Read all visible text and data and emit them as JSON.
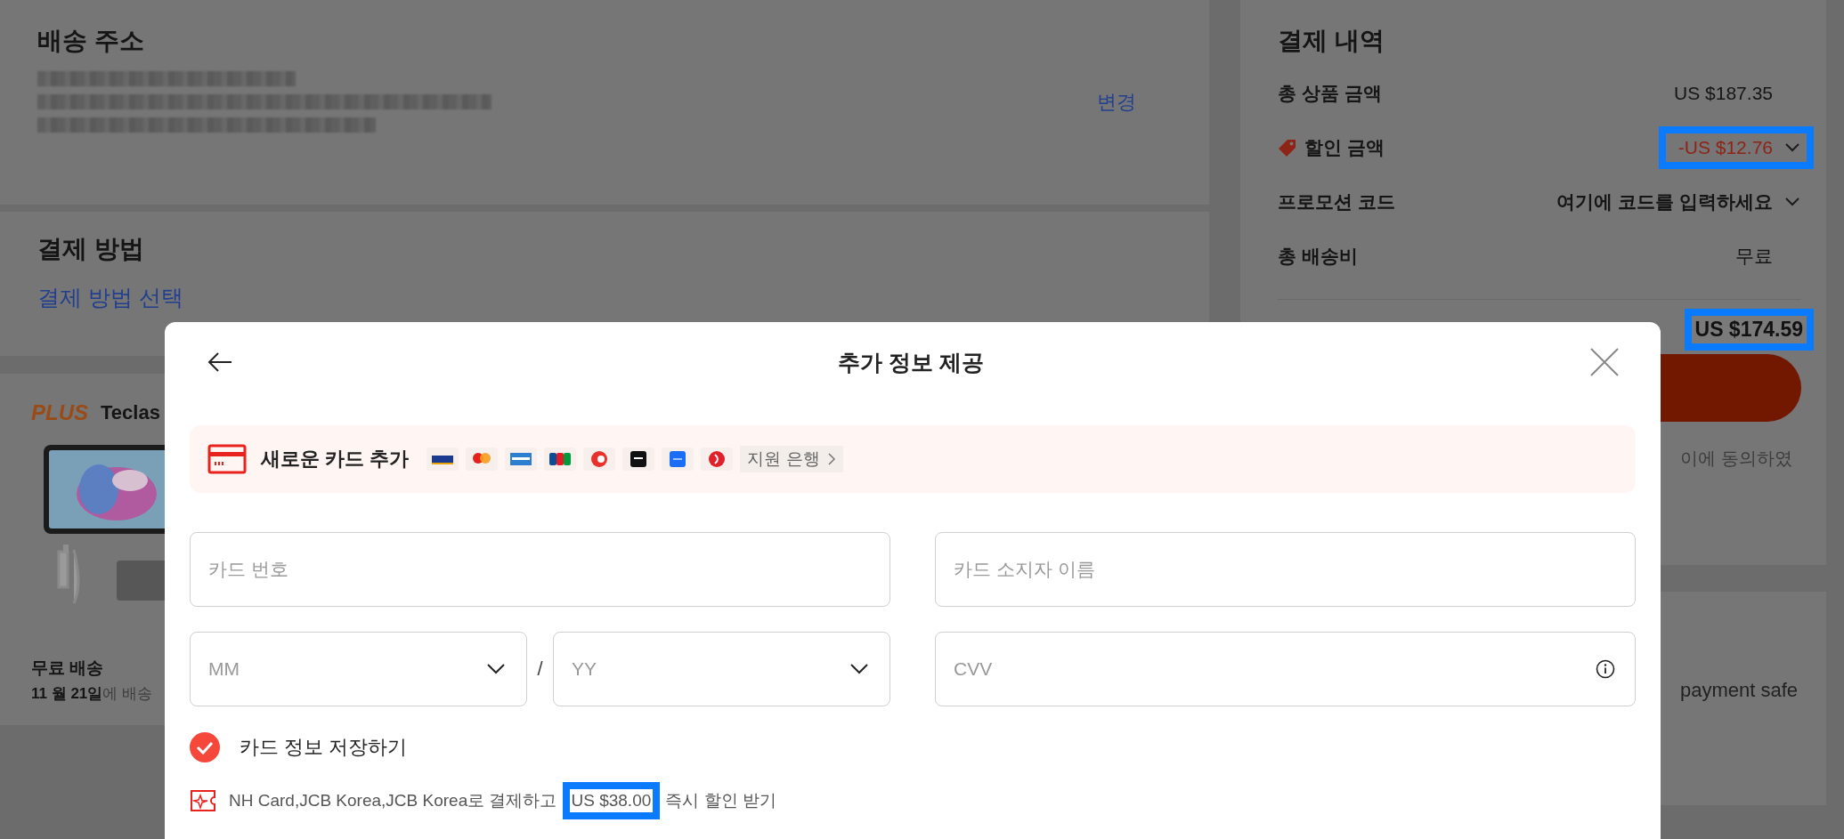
{
  "shipping_address": {
    "title": "배송 주소",
    "change_link": "변경"
  },
  "payment_method": {
    "title": "결제 방법",
    "select_link": "결제 방법 선택"
  },
  "product": {
    "badge": "PLUS",
    "store": "Teclas",
    "shipping": "무료 배송",
    "delivery": "**11 월 21일**에 배송"
  },
  "order_summary": {
    "title": "결제 내역",
    "rows": [
      {
        "kind": "amount",
        "label": "총 상품 금액",
        "value": "US $187.35",
        "highlighted": false
      },
      {
        "kind": "discount",
        "label": "할인 금액",
        "value": "-US $12.76",
        "highlighted": true
      },
      {
        "kind": "promo",
        "label": "프로모션 코드",
        "value": "여기에 코드를 입력하세요",
        "highlighted": false
      },
      {
        "kind": "amount",
        "label": "총 배송비",
        "value": "무료",
        "highlighted": false
      }
    ],
    "total": "US $174.59",
    "total_highlighted": true,
    "agreement": "이에 동의하였"
  },
  "safety": {
    "text": "payment safe"
  },
  "modal": {
    "title": "추가 정보 제공",
    "add_card": {
      "label": "새로운 카드 추가",
      "banks_link": "지원 은행"
    },
    "fields": [
      {
        "kind": "text",
        "placeholder": "카드 번호"
      },
      {
        "kind": "text",
        "placeholder": "카드 소지자 이름"
      },
      {
        "kind": "select",
        "placeholder": "MM"
      },
      {
        "kind": "select",
        "placeholder": "YY"
      },
      {
        "kind": "info",
        "placeholder": "CVV"
      }
    ],
    "expiry_separator": "/",
    "save_card": {
      "label": "카드 정보 저장하기",
      "checked": true
    },
    "promo": {
      "text": "NH Card,JCB Korea,JCB Korea로 결제하고",
      "amount": "US $38.00",
      "suffix": "즉시 할인 받기",
      "highlighted": true
    }
  }
}
